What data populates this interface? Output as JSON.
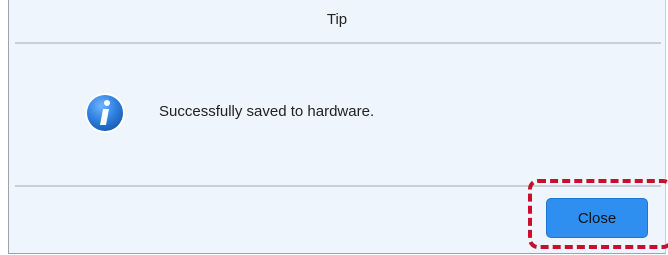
{
  "dialog": {
    "title": "Tip",
    "message": "Successfully saved to hardware.",
    "icon": "info-icon",
    "close_label": "Close"
  },
  "colors": {
    "dialog_bg": "#eef5fc",
    "button_bg": "#2f8ff0",
    "icon_blue": "#2f7fe0",
    "highlight": "#c8102e"
  }
}
